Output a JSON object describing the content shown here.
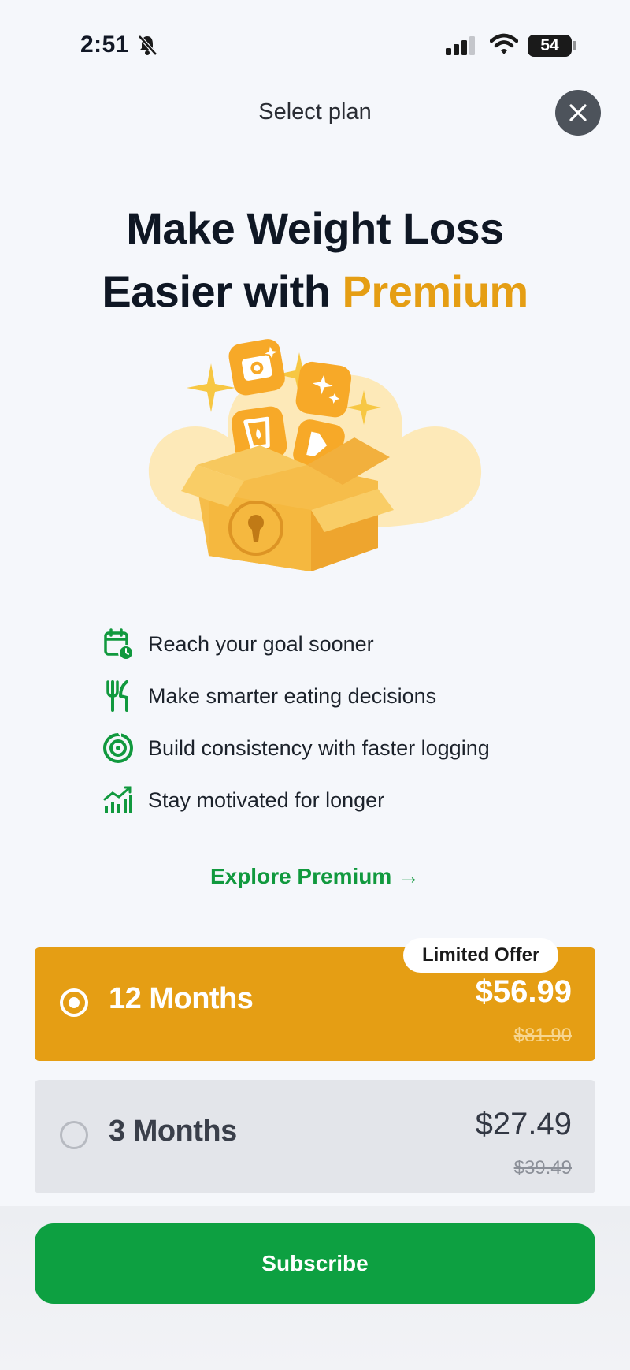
{
  "status_bar": {
    "time": "2:51",
    "battery": "54"
  },
  "header": {
    "title": "Select plan"
  },
  "headline": {
    "line1": "Make Weight Loss",
    "line2_prefix": "Easier with ",
    "line2_highlight": "Premium"
  },
  "features": [
    {
      "icon": "calendar-clock-icon",
      "text": "Reach your goal sooner"
    },
    {
      "icon": "fork-knife-icon",
      "text": "Make smarter eating decisions"
    },
    {
      "icon": "target-icon",
      "text": "Build consistency with faster logging"
    },
    {
      "icon": "growth-chart-icon",
      "text": "Stay motivated for longer"
    }
  ],
  "explore": {
    "label": "Explore Premium",
    "arrow": "→"
  },
  "plans": [
    {
      "name": "12 Months",
      "price": "$56.99",
      "old_price": "$81.90",
      "badge": "Limited Offer",
      "selected": true
    },
    {
      "name": "3 Months",
      "price": "$27.49",
      "old_price": "$39.49",
      "selected": false
    }
  ],
  "subscribe": {
    "label": "Subscribe"
  },
  "colors": {
    "accent": "#e59e14",
    "green": "#0da041",
    "feature_green": "#11993e"
  }
}
